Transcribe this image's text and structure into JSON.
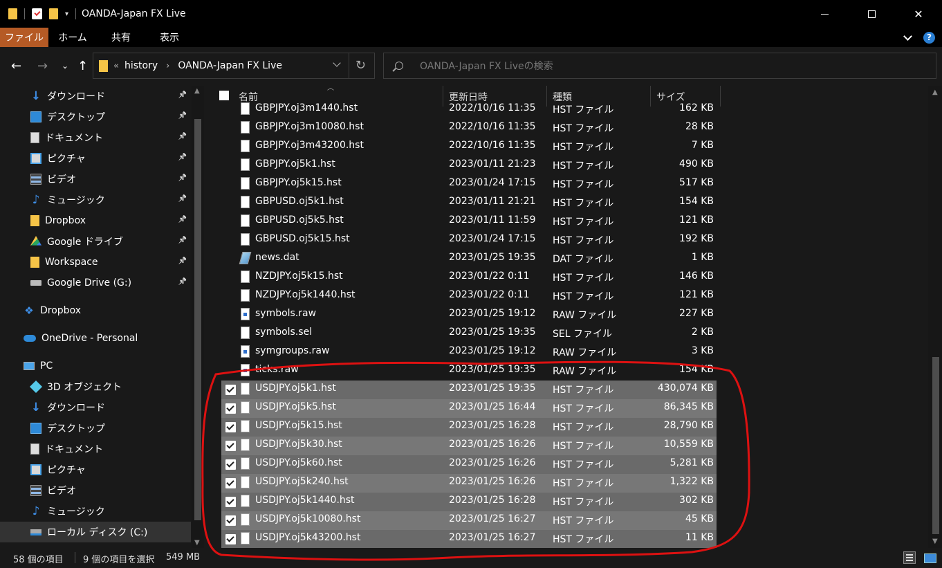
{
  "window": {
    "title": "OANDA-Japan FX Live"
  },
  "ribbon": {
    "tabs": [
      "ファイル",
      "ホーム",
      "共有",
      "表示"
    ]
  },
  "address": {
    "crumbs": [
      "history",
      "OANDA-Japan FX Live"
    ],
    "overflow": "«"
  },
  "search": {
    "placeholder": "OANDA-Japan FX Liveの検索"
  },
  "sidebar": {
    "items": [
      {
        "label": "ダウンロード",
        "icon": "download-icon",
        "pinned": true
      },
      {
        "label": "デスクトップ",
        "icon": "desktop-icon",
        "pinned": true
      },
      {
        "label": "ドキュメント",
        "icon": "document-icon",
        "pinned": true
      },
      {
        "label": "ピクチャ",
        "icon": "pictures-icon",
        "pinned": true
      },
      {
        "label": "ビデオ",
        "icon": "video-icon",
        "pinned": true
      },
      {
        "label": "ミュージック",
        "icon": "music-icon",
        "pinned": true
      },
      {
        "label": "Dropbox",
        "icon": "folder-icon",
        "pinned": true
      },
      {
        "label": "Google ドライブ",
        "icon": "google-drive-icon",
        "pinned": true
      },
      {
        "label": "Workspace",
        "icon": "folder-icon",
        "pinned": true
      },
      {
        "label": "Google Drive (G:)",
        "icon": "drive-icon",
        "pinned": true
      },
      {
        "label": "Dropbox",
        "icon": "dropbox-icon",
        "pinned": false
      },
      {
        "label": "OneDrive - Personal",
        "icon": "onedrive-icon",
        "pinned": false
      },
      {
        "label": "PC",
        "icon": "pc-icon",
        "pinned": false
      },
      {
        "label": "3D オブジェクト",
        "icon": "3d-objects-icon",
        "pinned": false
      },
      {
        "label": "ダウンロード",
        "icon": "download-icon",
        "pinned": false
      },
      {
        "label": "デスクトップ",
        "icon": "desktop-icon",
        "pinned": false
      },
      {
        "label": "ドキュメント",
        "icon": "document-icon",
        "pinned": false
      },
      {
        "label": "ピクチャ",
        "icon": "pictures-icon",
        "pinned": false
      },
      {
        "label": "ビデオ",
        "icon": "video-icon",
        "pinned": false
      },
      {
        "label": "ミュージック",
        "icon": "music-icon",
        "pinned": false
      },
      {
        "label": "ローカル ディスク (C:)",
        "icon": "local-disk-icon",
        "pinned": false,
        "selected": true
      }
    ]
  },
  "columns": [
    "名前",
    "更新日時",
    "種類",
    "サイズ"
  ],
  "files": [
    {
      "name": "GBPJPY.oj3m1440.hst",
      "date": "2022/10/16 11:35",
      "type": "HST ファイル",
      "size": "162 KB",
      "icon": "file-icon",
      "selected": false
    },
    {
      "name": "GBPJPY.oj3m10080.hst",
      "date": "2022/10/16 11:35",
      "type": "HST ファイル",
      "size": "28 KB",
      "icon": "file-icon",
      "selected": false
    },
    {
      "name": "GBPJPY.oj3m43200.hst",
      "date": "2022/10/16 11:35",
      "type": "HST ファイル",
      "size": "7 KB",
      "icon": "file-icon",
      "selected": false
    },
    {
      "name": "GBPJPY.oj5k1.hst",
      "date": "2023/01/11 21:23",
      "type": "HST ファイル",
      "size": "490 KB",
      "icon": "file-icon",
      "selected": false
    },
    {
      "name": "GBPJPY.oj5k15.hst",
      "date": "2023/01/24 17:15",
      "type": "HST ファイル",
      "size": "517 KB",
      "icon": "file-icon",
      "selected": false
    },
    {
      "name": "GBPUSD.oj5k1.hst",
      "date": "2023/01/11 21:21",
      "type": "HST ファイル",
      "size": "154 KB",
      "icon": "file-icon",
      "selected": false
    },
    {
      "name": "GBPUSD.oj5k5.hst",
      "date": "2023/01/11 11:59",
      "type": "HST ファイル",
      "size": "121 KB",
      "icon": "file-icon",
      "selected": false
    },
    {
      "name": "GBPUSD.oj5k15.hst",
      "date": "2023/01/24 17:15",
      "type": "HST ファイル",
      "size": "192 KB",
      "icon": "file-icon",
      "selected": false
    },
    {
      "name": "news.dat",
      "date": "2023/01/25 19:35",
      "type": "DAT ファイル",
      "size": "1 KB",
      "icon": "dat-file-icon",
      "selected": false
    },
    {
      "name": "NZDJPY.oj5k15.hst",
      "date": "2023/01/22 0:11",
      "type": "HST ファイル",
      "size": "146 KB",
      "icon": "file-icon",
      "selected": false
    },
    {
      "name": "NZDJPY.oj5k1440.hst",
      "date": "2023/01/22 0:11",
      "type": "HST ファイル",
      "size": "121 KB",
      "icon": "file-icon",
      "selected": false
    },
    {
      "name": "symbols.raw",
      "date": "2023/01/25 19:12",
      "type": "RAW ファイル",
      "size": "227 KB",
      "icon": "raw-file-icon",
      "selected": false
    },
    {
      "name": "symbols.sel",
      "date": "2023/01/25 19:35",
      "type": "SEL ファイル",
      "size": "2 KB",
      "icon": "file-icon",
      "selected": false
    },
    {
      "name": "symgroups.raw",
      "date": "2023/01/25 19:12",
      "type": "RAW ファイル",
      "size": "3 KB",
      "icon": "raw-file-icon",
      "selected": false
    },
    {
      "name": "ticks.raw",
      "date": "2023/01/25 19:35",
      "type": "RAW ファイル",
      "size": "154 KB",
      "icon": "raw-file-icon",
      "selected": false
    },
    {
      "name": "USDJPY.oj5k1.hst",
      "date": "2023/01/25 19:35",
      "type": "HST ファイル",
      "size": "430,074 KB",
      "icon": "file-icon",
      "selected": true
    },
    {
      "name": "USDJPY.oj5k5.hst",
      "date": "2023/01/25 16:44",
      "type": "HST ファイル",
      "size": "86,345 KB",
      "icon": "file-icon",
      "selected": true
    },
    {
      "name": "USDJPY.oj5k15.hst",
      "date": "2023/01/25 16:28",
      "type": "HST ファイル",
      "size": "28,790 KB",
      "icon": "file-icon",
      "selected": true
    },
    {
      "name": "USDJPY.oj5k30.hst",
      "date": "2023/01/25 16:26",
      "type": "HST ファイル",
      "size": "10,559 KB",
      "icon": "file-icon",
      "selected": true
    },
    {
      "name": "USDJPY.oj5k60.hst",
      "date": "2023/01/25 16:26",
      "type": "HST ファイル",
      "size": "5,281 KB",
      "icon": "file-icon",
      "selected": true
    },
    {
      "name": "USDJPY.oj5k240.hst",
      "date": "2023/01/25 16:26",
      "type": "HST ファイル",
      "size": "1,322 KB",
      "icon": "file-icon",
      "selected": true
    },
    {
      "name": "USDJPY.oj5k1440.hst",
      "date": "2023/01/25 16:28",
      "type": "HST ファイル",
      "size": "302 KB",
      "icon": "file-icon",
      "selected": true
    },
    {
      "name": "USDJPY.oj5k10080.hst",
      "date": "2023/01/25 16:27",
      "type": "HST ファイル",
      "size": "45 KB",
      "icon": "file-icon",
      "selected": true
    },
    {
      "name": "USDJPY.oj5k43200.hst",
      "date": "2023/01/25 16:27",
      "type": "HST ファイル",
      "size": "11 KB",
      "icon": "file-icon",
      "selected": true
    }
  ],
  "status": {
    "item_count": "58 個の項目",
    "selection": "9 個の項目を選択",
    "selection_size": "549 MB"
  },
  "colors": {
    "selection_row": "#777777",
    "ribbon_active": "#b55a25",
    "annotation": "#dd1111"
  }
}
